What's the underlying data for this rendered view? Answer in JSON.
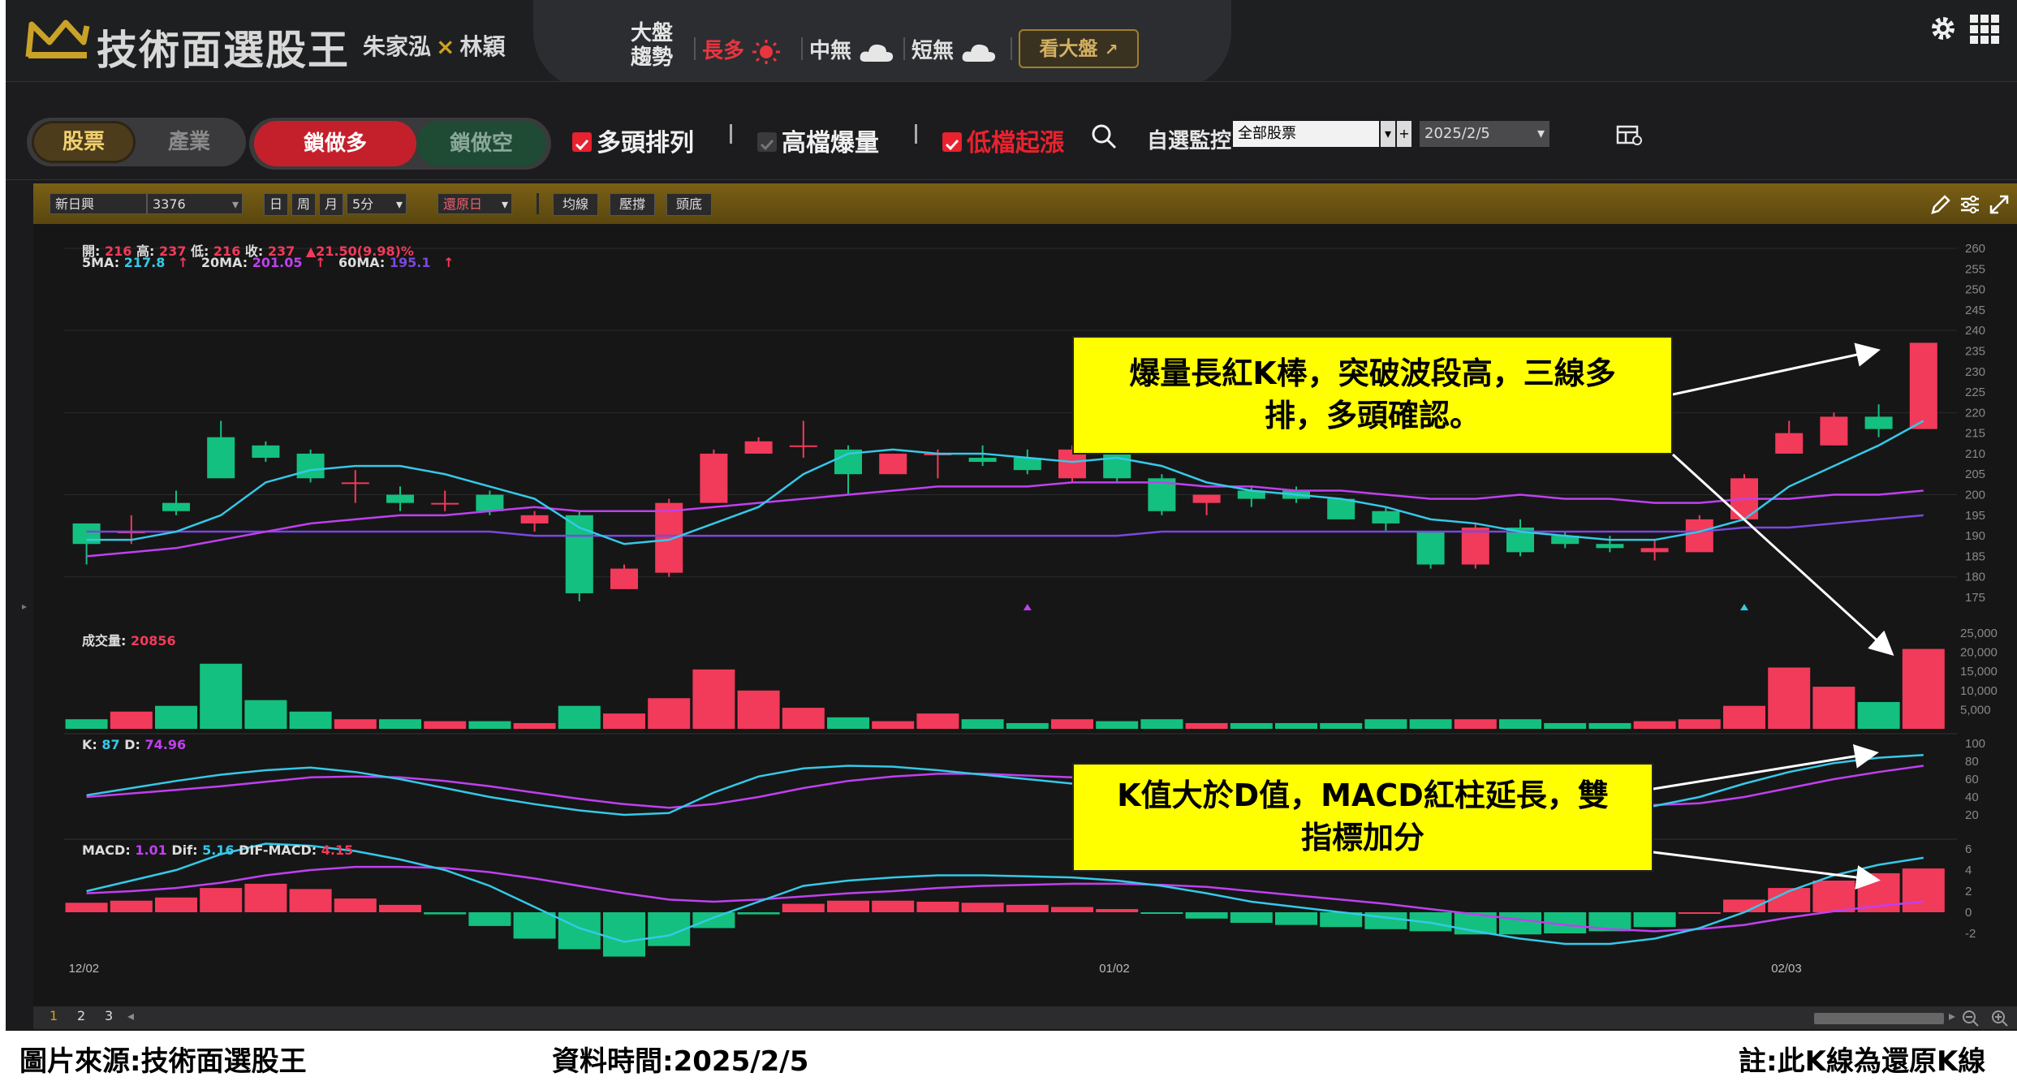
{
  "header": {
    "brand": "技術面選股王",
    "author1": "朱家泓",
    "author_sep": "×",
    "author2": "林穎",
    "trend_label_line1": "大盤",
    "trend_label_line2": "趨勢",
    "long_term": "長多",
    "mid_term": "中無",
    "short_term": "短無",
    "market_button": "看大盤"
  },
  "filters": {
    "tab_stock": "股票",
    "tab_industry": "產業",
    "tab_long": "鎖做多",
    "tab_short": "鎖做空",
    "check1": "多頭排列",
    "check2": "高檔爆量",
    "check3": "低檔起漲",
    "watch_label": "自選監控",
    "watch_select": "全部股票",
    "date": "2025/2/5"
  },
  "toolbar": {
    "stock_name": "新日興",
    "stock_code": "3376",
    "day": "日",
    "week": "周",
    "month": "月",
    "interval": "5分",
    "restore": "還原日",
    "ma_btn": "均線",
    "pressure_btn": "壓撐",
    "top_bottom_btn": "頭底"
  },
  "legend": {
    "open_label": "開:",
    "open": "216",
    "high_label": "高:",
    "high": "237",
    "low_label": "低:",
    "low": "216",
    "close_label": "收:",
    "close": "237",
    "change": "▲21.50(9.98)%",
    "ma5_label": "5MA:",
    "ma5": "217.8",
    "ma20_label": "20MA:",
    "ma20": "201.05",
    "ma60_label": "60MA:",
    "ma60": "195.1",
    "up_arrow": "↑",
    "vol_label": "成交量:",
    "vol": "20856",
    "k_label": "K:",
    "k": "87",
    "d_label": "D:",
    "d": "74.96",
    "macd_label": "MACD:",
    "macd": "1.01",
    "dif_label": "Dif:",
    "dif": "5.16",
    "difmacd_label": "DIF-MACD:",
    "difmacd": "4.15"
  },
  "callouts": {
    "top_line1": "爆量長紅K棒，突破波段高，三線多",
    "top_line2": "排，多頭確認。",
    "bottom_line1": "K值大於D值，MACD紅柱延長，雙",
    "bottom_line2": "指標加分"
  },
  "pages": [
    "1",
    "2",
    "3"
  ],
  "footer": {
    "source": "圖片來源:技術面選股王",
    "time": "資料時間:2025/2/5",
    "note": "註:此K線為還原K線"
  },
  "colors": {
    "up": "#f23a5a",
    "down": "#14c07f",
    "ma5": "#35c9e8",
    "ma20": "#c040f0",
    "ma60": "#7a48e0",
    "gold": "#c9a227"
  },
  "chart_data": {
    "type": "candlestick",
    "x_labels": [
      "12/02",
      "01/02",
      "02/03"
    ],
    "price_axis": [
      175,
      180,
      185,
      190,
      195,
      200,
      205,
      210,
      215,
      220,
      225,
      230,
      235,
      240,
      245,
      250,
      255,
      260
    ],
    "volume_axis": [
      "5,000",
      "10,000",
      "15,000",
      "20,000",
      "25,000"
    ],
    "kd_axis": [
      20,
      40,
      60,
      80,
      100
    ],
    "macd_axis": [
      -2,
      0,
      2,
      4,
      6
    ],
    "candles": [
      [
        193,
        188,
        193,
        183
      ],
      [
        191,
        191,
        195,
        188
      ],
      [
        198,
        196,
        201,
        195
      ],
      [
        214,
        204,
        218,
        204
      ],
      [
        212,
        209,
        213,
        208
      ],
      [
        210,
        204,
        211,
        203
      ],
      [
        203,
        203,
        206,
        198
      ],
      [
        200,
        198,
        202,
        196
      ],
      [
        198,
        198,
        201,
        196
      ],
      [
        200,
        196,
        201,
        195
      ],
      [
        193,
        195,
        196,
        191
      ],
      [
        195,
        176,
        196,
        174
      ],
      [
        177,
        182,
        183,
        177
      ],
      [
        181,
        198,
        199,
        180
      ],
      [
        198,
        210,
        211,
        198
      ],
      [
        210,
        213,
        214,
        210
      ],
      [
        212,
        212,
        218,
        209
      ],
      [
        211,
        205,
        212,
        200
      ],
      [
        205,
        210,
        210,
        205
      ],
      [
        210,
        210,
        211,
        204
      ],
      [
        209,
        208,
        212,
        207
      ],
      [
        209,
        206,
        211,
        205
      ],
      [
        204,
        211,
        212,
        203
      ],
      [
        210,
        204,
        211,
        203
      ],
      [
        204,
        196,
        205,
        195
      ],
      [
        198,
        200,
        200,
        195
      ],
      [
        201,
        199,
        202,
        197
      ],
      [
        201,
        199,
        202,
        198
      ],
      [
        199,
        194,
        199,
        194
      ],
      [
        196,
        193,
        197,
        191
      ],
      [
        191,
        183,
        191,
        182
      ],
      [
        183,
        192,
        193,
        182
      ],
      [
        192,
        186,
        194,
        185
      ],
      [
        190,
        188,
        191,
        187
      ],
      [
        188,
        187,
        190,
        186
      ],
      [
        186,
        187,
        189,
        184
      ],
      [
        186,
        194,
        195,
        186
      ],
      [
        194,
        204,
        205,
        194
      ],
      [
        210,
        215,
        218,
        210
      ],
      [
        212,
        219,
        220,
        212
      ],
      [
        219,
        216,
        222,
        214
      ],
      [
        216,
        237,
        237,
        216
      ]
    ],
    "volume": [
      2500,
      4500,
      6000,
      17000,
      7500,
      4500,
      2500,
      2500,
      2000,
      2000,
      1500,
      6000,
      4000,
      8000,
      15500,
      10000,
      5500,
      3000,
      2000,
      4000,
      2500,
      1500,
      2500,
      2000,
      2500,
      1500,
      1500,
      1500,
      1500,
      2500,
      2500,
      2500,
      2500,
      1500,
      1500,
      2000,
      2500,
      6000,
      16000,
      11000,
      7000,
      20856
    ],
    "ma5": [
      189,
      189,
      191,
      195,
      203,
      206,
      207,
      207,
      205,
      202,
      199,
      192,
      188,
      189,
      193,
      197,
      205,
      210,
      211,
      210,
      210,
      209,
      208,
      209,
      207,
      203,
      201,
      200,
      199,
      197,
      194,
      193,
      191,
      190,
      189,
      189,
      191,
      194,
      202,
      207,
      212,
      218
    ],
    "ma20": [
      185,
      186,
      187,
      189,
      191,
      193,
      194,
      195,
      195,
      196,
      197,
      196,
      196,
      196,
      197,
      198,
      199,
      200,
      201,
      202,
      202,
      202,
      203,
      203,
      203,
      202,
      202,
      201,
      201,
      200,
      199,
      199,
      200,
      199,
      199,
      198,
      198,
      199,
      199,
      200,
      200,
      201
    ],
    "ma60": [
      191,
      191,
      191,
      191,
      191,
      191,
      191,
      191,
      191,
      191,
      190,
      190,
      190,
      190,
      190,
      190,
      190,
      190,
      190,
      190,
      190,
      190,
      190,
      190,
      191,
      191,
      191,
      191,
      191,
      191,
      191,
      191,
      191,
      191,
      191,
      191,
      191,
      192,
      192,
      193,
      194,
      195
    ],
    "k": [
      42,
      50,
      58,
      65,
      70,
      73,
      68,
      60,
      50,
      40,
      32,
      25,
      20,
      22,
      45,
      63,
      72,
      75,
      74,
      70,
      65,
      60,
      55,
      50,
      48,
      45,
      42,
      40,
      38,
      35,
      32,
      30,
      28,
      27,
      28,
      30,
      40,
      55,
      68,
      78,
      84,
      87
    ],
    "d": [
      40,
      44,
      48,
      52,
      57,
      62,
      63,
      62,
      58,
      52,
      45,
      38,
      32,
      28,
      32,
      40,
      50,
      58,
      63,
      66,
      66,
      64,
      62,
      59,
      57,
      54,
      51,
      48,
      46,
      43,
      40,
      37,
      34,
      32,
      31,
      31,
      33,
      40,
      50,
      60,
      68,
      74.96
    ],
    "dif": [
      2,
      3,
      4,
      5.5,
      6.5,
      6.3,
      5.8,
      5,
      4,
      2.5,
      0.5,
      -1.5,
      -2.8,
      -2.2,
      -0.5,
      1,
      2.5,
      3,
      3.3,
      3.5,
      3.5,
      3.4,
      3.3,
      3,
      2.5,
      1.8,
      1,
      0.5,
      0,
      -0.5,
      -1,
      -1.8,
      -2.5,
      -3,
      -3,
      -2.5,
      -1.5,
      0,
      2,
      3.5,
      4.5,
      5.16
    ],
    "macd": [
      1.8,
      2,
      2.3,
      2.8,
      3.5,
      4,
      4.3,
      4.3,
      4.2,
      3.8,
      3.2,
      2.5,
      1.8,
      1.2,
      1,
      1.2,
      1.5,
      1.8,
      2,
      2.3,
      2.5,
      2.6,
      2.7,
      2.7,
      2.6,
      2.4,
      2,
      1.6,
      1.2,
      0.8,
      0.3,
      -0.2,
      -0.7,
      -1.2,
      -1.6,
      -1.8,
      -1.6,
      -1.2,
      -0.5,
      0.1,
      0.6,
      1.01
    ],
    "osc": [
      0.9,
      1.1,
      1.4,
      2.3,
      2.7,
      2.2,
      1.3,
      0.7,
      -0.2,
      -1.3,
      -2.5,
      -3.5,
      -4.2,
      -3.2,
      -1.5,
      -0.2,
      0.8,
      1.1,
      1.1,
      1,
      0.9,
      0.7,
      0.5,
      0.3,
      -0.1,
      -0.6,
      -1,
      -1.2,
      -1.4,
      -1.6,
      -1.8,
      -2.1,
      -2.1,
      -2,
      -1.8,
      -1.4,
      0,
      1.2,
      2.3,
      3,
      3.7,
      4.15
    ]
  }
}
